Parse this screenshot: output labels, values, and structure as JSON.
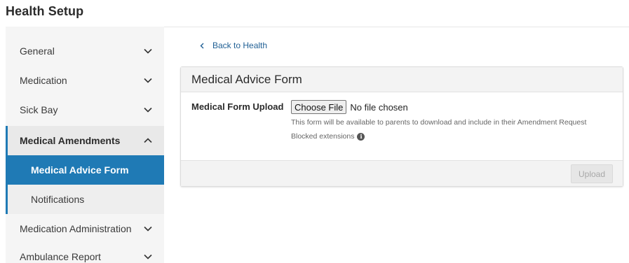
{
  "page": {
    "title": "Health Setup"
  },
  "sidebar": {
    "items": [
      {
        "label": "General"
      },
      {
        "label": "Medication"
      },
      {
        "label": "Sick Bay"
      },
      {
        "label": "Medical Amendments"
      },
      {
        "label": "Medication Administration"
      },
      {
        "label": "Ambulance Report"
      }
    ],
    "sub_items": [
      {
        "label": "Medical Advice Form"
      },
      {
        "label": "Notifications"
      }
    ]
  },
  "main": {
    "back_label": "Back to Health",
    "card": {
      "title": "Medical Advice Form",
      "field_label": "Medical Form Upload",
      "choose_file_label": "Choose File",
      "file_status": "No file chosen",
      "help_text": "This form will be available to parents to download and include in their Amendment Request",
      "blocked_label": "Blocked extensions",
      "info_glyph": "i",
      "upload_label": "Upload"
    }
  },
  "colors": {
    "accent": "#1f7ab5",
    "sidebar_bg": "#f5f5f5"
  }
}
